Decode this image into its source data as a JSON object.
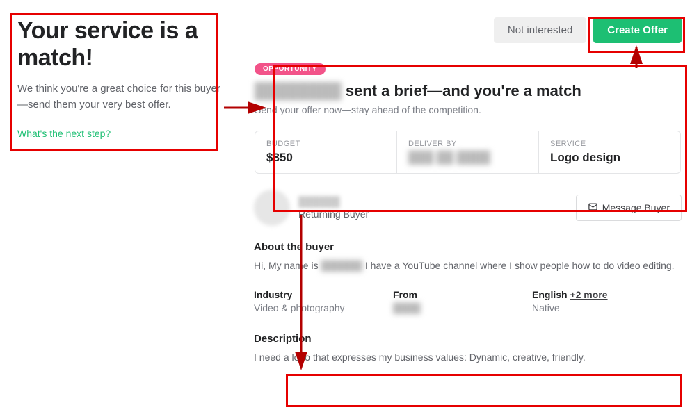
{
  "left": {
    "title": "Your service is a match!",
    "subtitle": "We think you're a great choice for this buyer—send them your very best offer.",
    "next_step": "What's the next step?"
  },
  "actions": {
    "not_interested": "Not interested",
    "create_offer": "Create Offer"
  },
  "card": {
    "badge": "OPPORTUNITY",
    "buyer_name_hidden": "████████",
    "title_suffix": " sent a brief—and you're a match",
    "subtitle": "Send your offer now—stay ahead of the competition.",
    "stats": {
      "budget_label": "BUDGET",
      "budget_value": "$350",
      "deliver_label": "DELIVER BY",
      "deliver_value": "███ ██ ████",
      "service_label": "SERVICE",
      "service_value": "Logo design"
    }
  },
  "buyer": {
    "name_hidden": "██████",
    "returning": "Returning Buyer",
    "message_btn": "Message Buyer",
    "about_heading": "About the buyer",
    "about_pre": "Hi, My name is ",
    "about_hidden": "██████",
    "about_post": " I have a YouTube channel where I show people how to do video editing.",
    "meta": {
      "industry_label": "Industry",
      "industry_value": "Video & photography",
      "from_label": "From",
      "from_value": "████",
      "lang_label": "English",
      "lang_more": "+2 more",
      "lang_value": "Native"
    }
  },
  "description": {
    "heading": "Description",
    "text": "I need a logo that expresses my business values: Dynamic, creative, friendly."
  }
}
